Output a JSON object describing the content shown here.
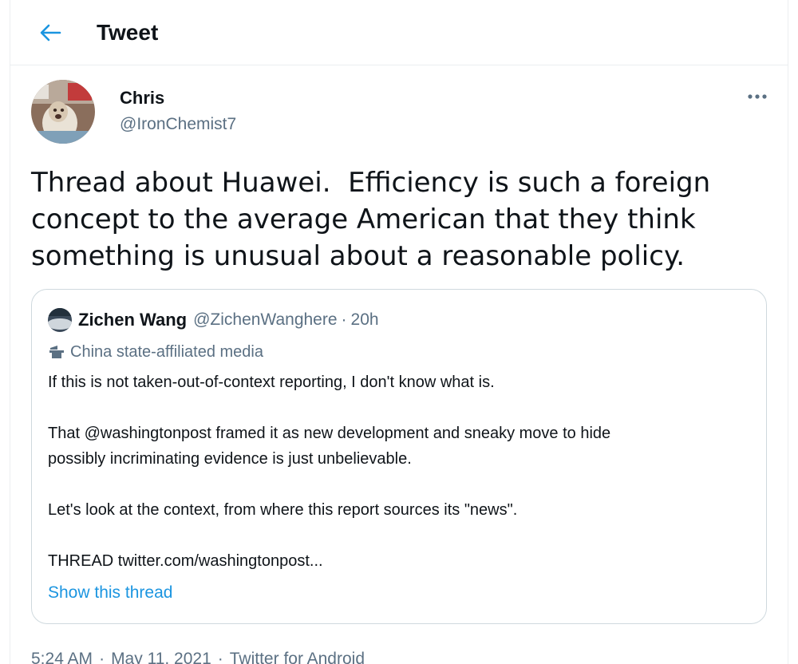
{
  "header": {
    "title": "Tweet"
  },
  "colors": {
    "accent": "#1b95e0",
    "secondary_text": "#5b7083",
    "primary_text": "#0f1419",
    "border": "#cfd9de"
  },
  "tweet": {
    "author_name": "Chris",
    "author_handle": "@IronChemist7",
    "text": "Thread about Huawei.  Efficiency is such a foreign concept to the average American that they think something is unusual about a reasonable policy.",
    "more_icon": "more-horizontal-icon",
    "meta": {
      "time": "5:24 AM",
      "date": "May 11, 2021",
      "source": "Twitter for Android",
      "separator": "·"
    }
  },
  "quoted_tweet": {
    "author_name": "Zichen Wang",
    "author_handle": "@ZichenWanghere",
    "separator": "·",
    "time_ago": "20h",
    "label": "China state-affiliated media",
    "label_icon": "state-media-podium-icon",
    "paragraphs": [
      "If this is not taken-out-of-context reporting, I don't know what is.",
      "That @washingtonpost framed it as new development and sneaky move to hide\npossibly incriminating evidence is just unbelievable.",
      "Let's look at the context, from where this report sources its \"news\".",
      "THREAD twitter.com/washingtonpost..."
    ],
    "show_thread": "Show this thread"
  }
}
